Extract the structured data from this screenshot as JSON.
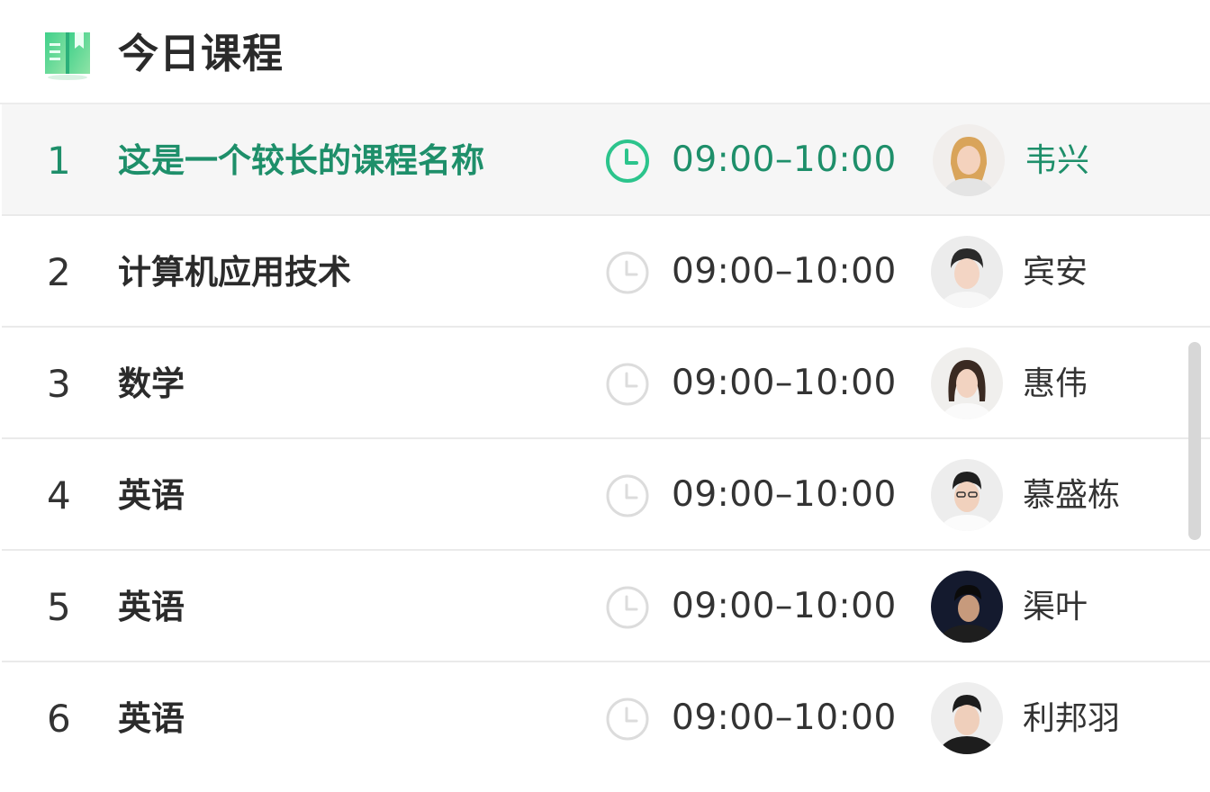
{
  "header": {
    "title": "今日课程",
    "icon": "book-icon"
  },
  "colors": {
    "accent": "#1e8f6a",
    "clock_active": "#2cc48c",
    "clock_inactive": "#dcdcdc",
    "active_row_bg": "#f6f6f6",
    "divider": "#eaeaea"
  },
  "courses": [
    {
      "index": "1",
      "name": "这是一个较长的课程名称",
      "time": "09:00–10:00",
      "teacher": "韦兴",
      "active": true
    },
    {
      "index": "2",
      "name": "计算机应用技术",
      "time": "09:00–10:00",
      "teacher": "宾安",
      "active": false
    },
    {
      "index": "3",
      "name": "数学",
      "time": "09:00–10:00",
      "teacher": "惠伟",
      "active": false
    },
    {
      "index": "4",
      "name": "英语",
      "time": "09:00–10:00",
      "teacher": "慕盛栋",
      "active": false
    },
    {
      "index": "5",
      "name": "英语",
      "time": "09:00–10:00",
      "teacher": "渠叶",
      "active": false
    },
    {
      "index": "6",
      "name": "英语",
      "time": "09:00–10:00",
      "teacher": "利邦羽",
      "active": false
    }
  ]
}
